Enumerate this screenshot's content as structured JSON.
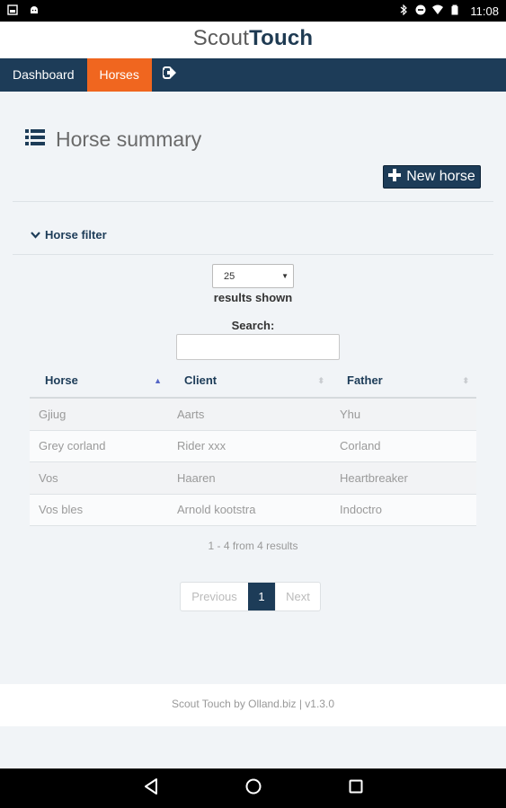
{
  "statusbar": {
    "time": "11:08",
    "icons": [
      "image-icon",
      "android-icon",
      "bluetooth-icon",
      "minus-circle-icon",
      "wifi-icon",
      "battery-icon"
    ]
  },
  "app": {
    "brand_light": "Scout",
    "brand_bold": "Touch"
  },
  "nav": {
    "items": [
      {
        "label": "Dashboard"
      },
      {
        "label": "Horses"
      }
    ],
    "logout_icon": "logout-icon",
    "active": "Horses"
  },
  "page": {
    "title": "Horse summary",
    "title_icon": "list-icon"
  },
  "buttons": {
    "new_horse": "New horse",
    "new_icon": "plus-icon"
  },
  "filter": {
    "toggle_label": "Horse filter",
    "toggle_icon": "chevron-down-icon"
  },
  "controls": {
    "page_size_value": "25",
    "results_label": "results shown",
    "search_label": "Search:",
    "search_value": ""
  },
  "table": {
    "columns": [
      {
        "label": "Horse",
        "sort": "asc"
      },
      {
        "label": "Client",
        "sort": "none"
      },
      {
        "label": "Father",
        "sort": "none"
      }
    ],
    "rows": [
      [
        "Gjiug",
        "Aarts",
        "Yhu"
      ],
      [
        "Grey corland",
        "Rider xxx",
        "Corland"
      ],
      [
        "Vos",
        "Haaren",
        "Heartbreaker"
      ],
      [
        "Vos bles",
        "Arnold kootstra",
        "Indoctro"
      ]
    ]
  },
  "pagination": {
    "info": "1 - 4 from 4 results",
    "previous": "Previous",
    "current": "1",
    "next": "Next"
  },
  "footer": {
    "text": "Scout Touch by Olland.biz | v1.3.0"
  },
  "colors": {
    "navy": "#1d3c58",
    "accent": "#f0661f",
    "background": "#f1f4f7"
  }
}
